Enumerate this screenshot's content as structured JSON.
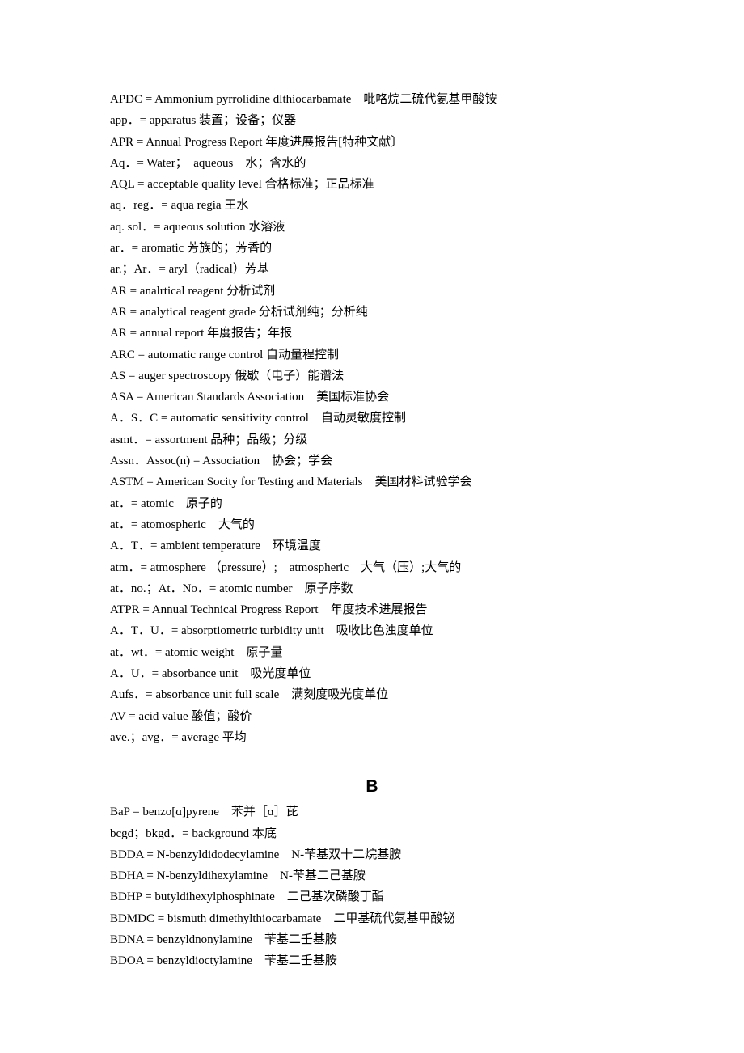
{
  "document": {
    "sections": [
      {
        "heading": "",
        "entries": [
          "APDC = Ammonium pyrrolidine dlthiocarbamate　吡咯烷二硫代氨基甲酸铵",
          "app．= apparatus  装置；设备；仪器",
          "APR = Annual Progress Report  年度进展报告[特种文献〕",
          "Aq．= Water；　aqueous　水；含水的",
          "AQL = acceptable quality level  合格标准；正品标准",
          "aq．reg．= aqua regia  王水",
          "aq. sol．= aqueous solution  水溶液",
          "ar．= aromatic  芳族的；芳香的",
          "ar.；Ar．= aryl（radical）芳基",
          "AR = analrtical reagent  分析试剂",
          "AR = analytical reagent grade  分析试剂纯；分析纯",
          "AR = annual report  年度报告；年报",
          "ARC = automatic range control  自动量程控制",
          "AS = auger spectroscopy  俄歇（电子）能谱法",
          "ASA = American Standards Association　美国标准协会",
          "A．S．C = automatic sensitivity control　自动灵敏度控制",
          "asmt．= assortment  品种；品级；分级",
          "Assn．Assoc(n) = Association　协会；学会",
          "ASTM = American Socity for Testing and Materials　美国材料试验学会",
          "at．= atomic　原子的",
          "at．= atomospheric　大气的",
          "A．T．= ambient temperature　环境温度",
          "atm．= atmosphere （pressure）;　atmospheric　大气（压）;大气的",
          "at．no.；At．No．= atomic number　原子序数",
          "ATPR = Annual Technical Progress Report　年度技术进展报告",
          "A．T．U．= absorptiometric turbidity unit　吸收比色浊度单位",
          "at．wt．= atomic weight　原子量",
          "A．U．= absorbance unit　吸光度单位",
          "Aufs．= absorbance unit full scale　满刻度吸光度单位",
          "AV = acid value  酸值；酸价",
          "ave.；avg．= average  平均"
        ]
      },
      {
        "heading": "B",
        "entries": [
          "BaP = benzo[ɑ]pyrene　苯并［ɑ］芘",
          "bcgd；bkgd．= background  本底",
          "BDDA = N-benzyldidodecylamine　N-苄基双十二烷基胺",
          "BDHA = N-benzyldihexylamine　N-苄基二己基胺",
          "BDHP = butyldihexylphosphinate　二己基次磷酸丁酯",
          "BDMDC = bismuth dimethylthiocarbamate　二甲基硫代氨基甲酸铋",
          "BDNA = benzyldnonylamine　苄基二壬基胺",
          "BDOA = benzyldioctylamine　苄基二壬基胺"
        ]
      }
    ]
  }
}
